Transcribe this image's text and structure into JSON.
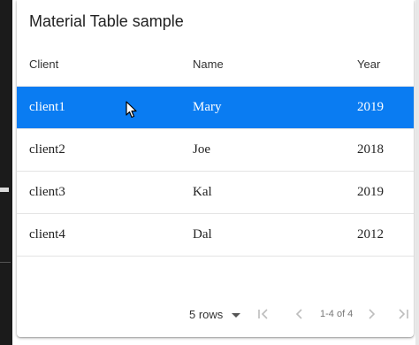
{
  "table": {
    "title": "Material Table sample",
    "columns": [
      "Client",
      "Name",
      "Year"
    ],
    "rows": [
      {
        "client": "client1",
        "name": "Mary",
        "year": "2019",
        "selected": true
      },
      {
        "client": "client2",
        "name": "Joe",
        "year": "2018",
        "selected": false
      },
      {
        "client": "client3",
        "name": "Kal",
        "year": "2019",
        "selected": false
      },
      {
        "client": "client4",
        "name": "Dal",
        "year": "2012",
        "selected": false
      }
    ]
  },
  "pagination": {
    "rows_per_page": "5 rows",
    "page_info": "1-4 of 4"
  },
  "colors": {
    "selected_row": "#0a7cf2",
    "disabled_icon": "#bdbdbd"
  }
}
